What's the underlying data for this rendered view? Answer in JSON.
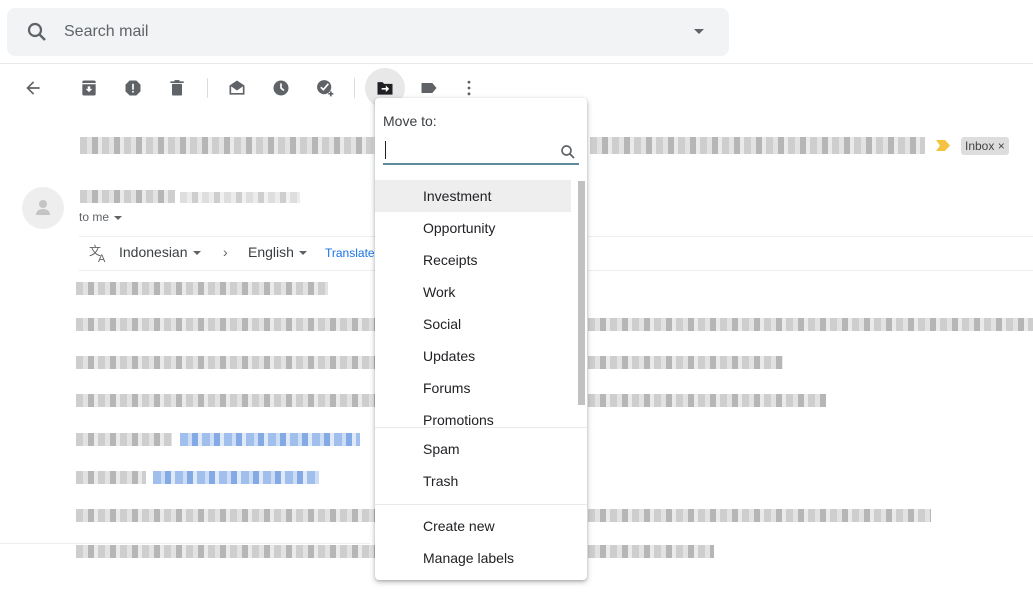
{
  "search": {
    "placeholder": "Search mail"
  },
  "toolbar": {
    "back": "back-arrow",
    "buttons": [
      "archive",
      "report-spam",
      "delete",
      "mark-unread",
      "snooze",
      "add-to-tasks",
      "move-to",
      "labels",
      "more"
    ]
  },
  "email": {
    "label_chip": "Inbox",
    "label_chip_close": "×",
    "recipient": "to me",
    "translate": {
      "from_lang": "Indonesian",
      "to_lang": "English",
      "action": "Translate",
      "separator": "›"
    }
  },
  "move_menu": {
    "title": "Move to:",
    "search_value": "",
    "folders": [
      "Investment",
      "Opportunity",
      "Receipts",
      "Work",
      "Social",
      "Updates",
      "Forums",
      "Promotions"
    ],
    "system": [
      "Spam",
      "Trash"
    ],
    "actions": [
      "Create new",
      "Manage labels"
    ],
    "highlighted": "Investment"
  },
  "colors": {
    "accent": "#1a73e8",
    "important_marker": "#f4c33f",
    "menu_input_underline": "#5f8a9c"
  }
}
